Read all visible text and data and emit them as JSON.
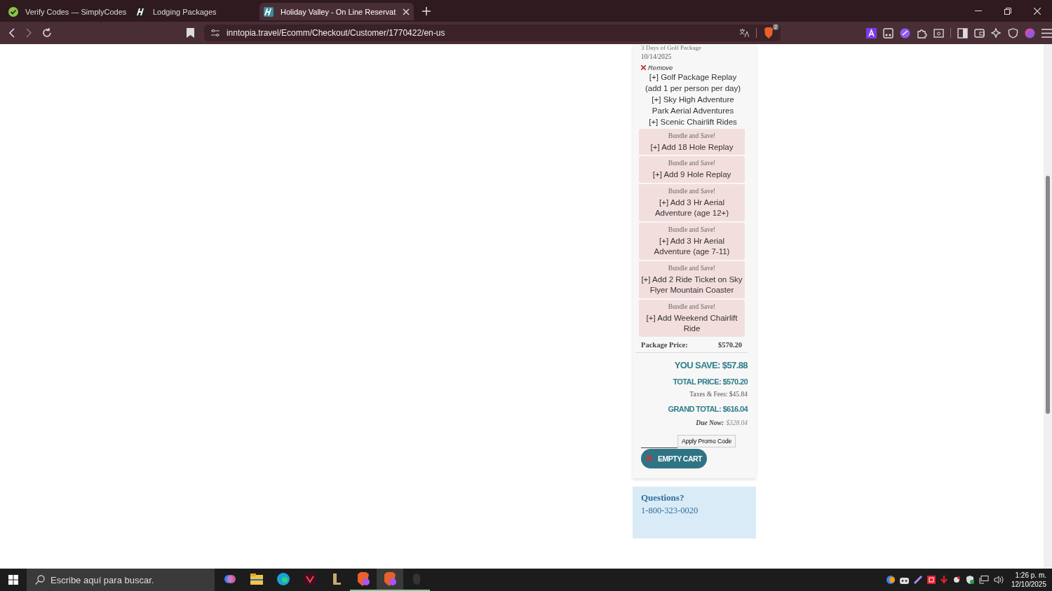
{
  "browser": {
    "tabs": [
      {
        "title": "Verify Codes — SimplyCodes",
        "selected": false,
        "kind": "check"
      },
      {
        "title": "Lodging Packages",
        "selected": false,
        "kind": "h-dark"
      },
      {
        "title": "Holiday Valley - On Line Reservat",
        "selected": true,
        "kind": "h-teal"
      }
    ],
    "url": "inntopia.travel/Ecomm/Checkout/Customer/1770422/en-us",
    "shield_badge": "2"
  },
  "cart": {
    "package_name": "3 Days of Golf Package",
    "date": "10/14/2025",
    "remove_label": "Remove",
    "addons": [
      "[+] Golf Package Replay (add 1 per person per day)",
      "[+] Sky High Adventure Park Aerial Adventures",
      "[+] Scenic Chairlift Rides"
    ],
    "bundles": [
      {
        "label": "Bundle and Save!",
        "text": "[+] Add 18 Hole Replay"
      },
      {
        "label": "Bundle and Save!",
        "text": "[+] Add 9 Hole Replay"
      },
      {
        "label": "Bundle and Save!",
        "text": "[+] Add 3 Hr Aerial Adventure (age 12+)"
      },
      {
        "label": "Bundle and Save!",
        "text": "[+] Add 3 Hr Aerial Adventure (age 7-11)"
      },
      {
        "label": "Bundle and Save!",
        "text": "[+] Add 2 Ride Ticket on Sky Flyer Mountain Coaster"
      },
      {
        "label": "Bundle and Save!",
        "text": "[+] Add Weekend Chairlift Ride"
      }
    ],
    "package_price_label": "Package Price:",
    "package_price": "$570.20",
    "you_save": "YOU SAVE: $57.88",
    "total_price": "TOTAL PRICE: $570.20",
    "taxes": "Taxes & Fees: $45.84",
    "grand_total": "GRAND TOTAL: $616.04",
    "due_now_label": "Due Now:",
    "due_now_value": "$328.04",
    "promo_button": "Apply Promo Code",
    "empty_cart_button": "EMPTY CART"
  },
  "questions": {
    "title": "Questions?",
    "phone": "1-800-323-0020"
  },
  "taskbar": {
    "search_placeholder": "Escribe aquí para buscar.",
    "time": "1:26 p. m.",
    "date": "12/10/2025"
  }
}
